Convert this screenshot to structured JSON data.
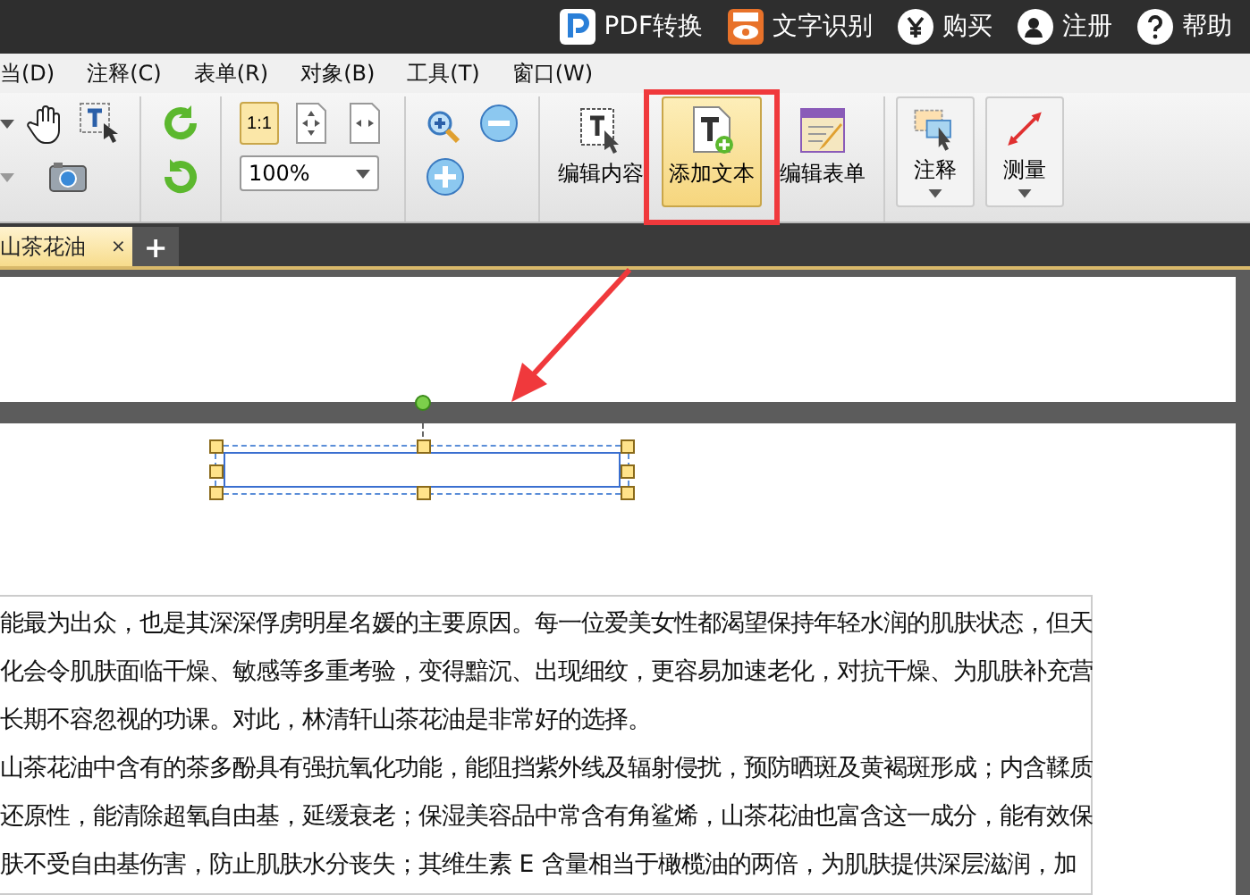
{
  "title_bar": {
    "items": [
      {
        "kind": "pdf",
        "label": "PDF转换"
      },
      {
        "kind": "ocr",
        "label": "文字识别"
      },
      {
        "kind": "buy",
        "label": "购买"
      },
      {
        "kind": "register",
        "label": "注册"
      },
      {
        "kind": "help",
        "label": "帮助"
      }
    ]
  },
  "menu": [
    "当(D)",
    "注释(C)",
    "表单(R)",
    "对象(B)",
    "工具(T)",
    "窗口(W)"
  ],
  "toolbar": {
    "actual_size": {
      "label": "1:1",
      "selected": true
    },
    "zoom": {
      "value": "100%"
    },
    "big_buttons": [
      {
        "kind": "edit-content",
        "label": "编辑内容",
        "selected": false,
        "dropdown": false
      },
      {
        "kind": "add-text",
        "label": "添加文本",
        "selected": true,
        "dropdown": false
      },
      {
        "kind": "edit-form",
        "label": "编辑表单",
        "selected": false,
        "dropdown": false
      },
      {
        "kind": "annotate",
        "label": "注释",
        "selected": false,
        "dropdown": true
      },
      {
        "kind": "measure",
        "label": "测量",
        "selected": false,
        "dropdown": true
      }
    ]
  },
  "tabs": [
    {
      "label": "山茶花油",
      "selected": true,
      "close": "×"
    }
  ],
  "new_tab": "+",
  "document": {
    "lines": [
      "能最为出众，也是其深深俘虏明星名媛的主要原因。每一位爱美女性都渴望保持年轻水润的肌肤状态，但天",
      "化会令肌肤面临干燥、敏感等多重考验，变得黯沉、出现细纹，更容易加速老化，对抗干燥、为肌肤补充营",
      "长期不容忽视的功课。对此，林清轩山茶花油是非常好的选择。",
      "山茶花油中含有的茶多酚具有强抗氧化功能，能阻挡紫外线及辐射侵扰，预防晒斑及黄褐斑形成；内含鞣质",
      "还原性，能清除超氧自由基，延缓衰老；保湿美容品中常含有角鲨烯，山茶花油也富含这一成分，能有效保",
      "肤不受自由基伤害，防止肌肤水分丧失；其维生素 E 含量相当于橄榄油的两倍，为肌肤提供深层滋润，加"
    ]
  }
}
